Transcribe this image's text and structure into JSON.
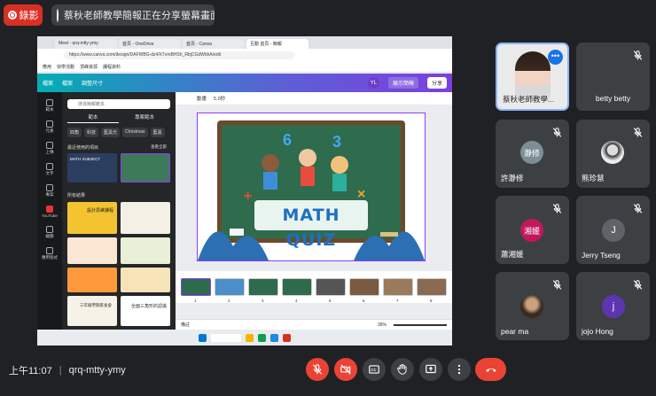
{
  "meeting": {
    "recording_label": "錄影",
    "presenter_label": "蔡秋老師教學簡報正在分享螢幕畫面",
    "time": "上午11:07",
    "meeting_code": "qrq-mtty-ymy"
  },
  "browser": {
    "tabs": [
      "Meet - qrq-mtty-ymy",
      "首頁 - OneDrive",
      "首頁 - Canva",
      "互動 首頁 - 簡報"
    ],
    "url": "https://www.canva.com/design/DAFWBG-dz4/X7vmBHSh_RbjCGdWbhA/edit",
    "bookmarks": [
      "應用",
      "快學活動",
      "頂峰資源",
      "課程資料"
    ]
  },
  "canva": {
    "menu": [
      "檔案",
      "檔案",
      "調整尺寸"
    ],
    "user_initials": "YL",
    "present_label": "展示簡報",
    "share_label": "分享",
    "rail": [
      "範本",
      "元素",
      "上傳",
      "文字",
      "專案",
      "YouTube",
      "繪圖",
      "應用程式"
    ],
    "search_placeholder": "搜尋簡報範本",
    "panel_tabs": [
      "範本",
      "專案範本"
    ],
    "chips": [
      "四角",
      "科技",
      "藍黑光",
      "Christmas",
      "藍黑"
    ],
    "recent_label": "最近使用的項目",
    "see_all": "查看全部",
    "all_results": "所有結果",
    "toolbar_anim": "動畫",
    "toolbar_duration": "5.0秒",
    "slide_title": "MATH QUIZ",
    "thumb_template1": "MATH SUBJECT",
    "template_titles": [
      "設計思維課程",
      "全面三角形的認識",
      "三年級學期家長會"
    ],
    "notes_label": "備註",
    "zoom": "36%",
    "pages": [
      "1",
      "2",
      "3",
      "4",
      "5",
      "6",
      "7",
      "8"
    ]
  },
  "participants": [
    {
      "name": "蔡秋老師教學...",
      "type": "video"
    },
    {
      "name": "betty betty",
      "type": "none"
    },
    {
      "name": "許瀞修",
      "initials": "瀞修",
      "color": "#7c8f96"
    },
    {
      "name": "熊珍慧",
      "type": "photo"
    },
    {
      "name": "蕭湘媛",
      "initials": "湘媛",
      "color": "#c2185b"
    },
    {
      "name": "Jerry Tseng",
      "initials": "J",
      "color": "#5f6368"
    },
    {
      "name": "pear ma",
      "type": "photo"
    },
    {
      "name": "jojo Hong",
      "initials": "j",
      "color": "#5e35b1"
    }
  ]
}
